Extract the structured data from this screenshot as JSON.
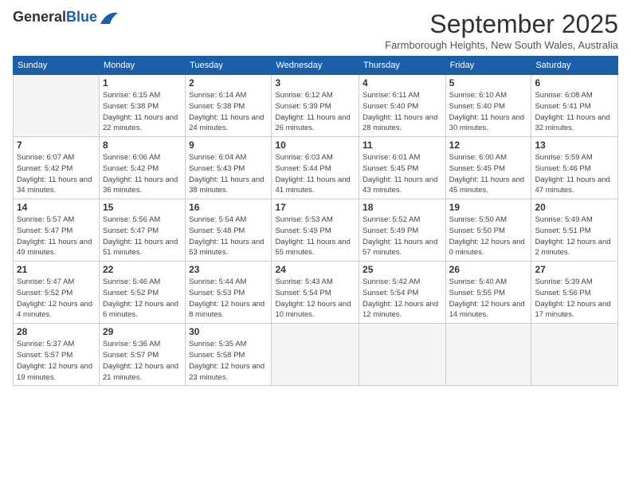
{
  "logo": {
    "general": "General",
    "blue": "Blue"
  },
  "title": "September 2025",
  "subtitle": "Farmborough Heights, New South Wales, Australia",
  "weekdays": [
    "Sunday",
    "Monday",
    "Tuesday",
    "Wednesday",
    "Thursday",
    "Friday",
    "Saturday"
  ],
  "weeks": [
    [
      {
        "day": "",
        "info": ""
      },
      {
        "day": "1",
        "info": "Sunrise: 6:15 AM\nSunset: 5:38 PM\nDaylight: 11 hours\nand 22 minutes."
      },
      {
        "day": "2",
        "info": "Sunrise: 6:14 AM\nSunset: 5:38 PM\nDaylight: 11 hours\nand 24 minutes."
      },
      {
        "day": "3",
        "info": "Sunrise: 6:12 AM\nSunset: 5:39 PM\nDaylight: 11 hours\nand 26 minutes."
      },
      {
        "day": "4",
        "info": "Sunrise: 6:11 AM\nSunset: 5:40 PM\nDaylight: 11 hours\nand 28 minutes."
      },
      {
        "day": "5",
        "info": "Sunrise: 6:10 AM\nSunset: 5:40 PM\nDaylight: 11 hours\nand 30 minutes."
      },
      {
        "day": "6",
        "info": "Sunrise: 6:08 AM\nSunset: 5:41 PM\nDaylight: 11 hours\nand 32 minutes."
      }
    ],
    [
      {
        "day": "7",
        "info": "Sunrise: 6:07 AM\nSunset: 5:42 PM\nDaylight: 11 hours\nand 34 minutes."
      },
      {
        "day": "8",
        "info": "Sunrise: 6:06 AM\nSunset: 5:42 PM\nDaylight: 11 hours\nand 36 minutes."
      },
      {
        "day": "9",
        "info": "Sunrise: 6:04 AM\nSunset: 5:43 PM\nDaylight: 11 hours\nand 38 minutes."
      },
      {
        "day": "10",
        "info": "Sunrise: 6:03 AM\nSunset: 5:44 PM\nDaylight: 11 hours\nand 41 minutes."
      },
      {
        "day": "11",
        "info": "Sunrise: 6:01 AM\nSunset: 5:45 PM\nDaylight: 11 hours\nand 43 minutes."
      },
      {
        "day": "12",
        "info": "Sunrise: 6:00 AM\nSunset: 5:45 PM\nDaylight: 11 hours\nand 45 minutes."
      },
      {
        "day": "13",
        "info": "Sunrise: 5:59 AM\nSunset: 5:46 PM\nDaylight: 11 hours\nand 47 minutes."
      }
    ],
    [
      {
        "day": "14",
        "info": "Sunrise: 5:57 AM\nSunset: 5:47 PM\nDaylight: 11 hours\nand 49 minutes."
      },
      {
        "day": "15",
        "info": "Sunrise: 5:56 AM\nSunset: 5:47 PM\nDaylight: 11 hours\nand 51 minutes."
      },
      {
        "day": "16",
        "info": "Sunrise: 5:54 AM\nSunset: 5:48 PM\nDaylight: 11 hours\nand 53 minutes."
      },
      {
        "day": "17",
        "info": "Sunrise: 5:53 AM\nSunset: 5:49 PM\nDaylight: 11 hours\nand 55 minutes."
      },
      {
        "day": "18",
        "info": "Sunrise: 5:52 AM\nSunset: 5:49 PM\nDaylight: 11 hours\nand 57 minutes."
      },
      {
        "day": "19",
        "info": "Sunrise: 5:50 AM\nSunset: 5:50 PM\nDaylight: 12 hours\nand 0 minutes."
      },
      {
        "day": "20",
        "info": "Sunrise: 5:49 AM\nSunset: 5:51 PM\nDaylight: 12 hours\nand 2 minutes."
      }
    ],
    [
      {
        "day": "21",
        "info": "Sunrise: 5:47 AM\nSunset: 5:52 PM\nDaylight: 12 hours\nand 4 minutes."
      },
      {
        "day": "22",
        "info": "Sunrise: 5:46 AM\nSunset: 5:52 PM\nDaylight: 12 hours\nand 6 minutes."
      },
      {
        "day": "23",
        "info": "Sunrise: 5:44 AM\nSunset: 5:53 PM\nDaylight: 12 hours\nand 8 minutes."
      },
      {
        "day": "24",
        "info": "Sunrise: 5:43 AM\nSunset: 5:54 PM\nDaylight: 12 hours\nand 10 minutes."
      },
      {
        "day": "25",
        "info": "Sunrise: 5:42 AM\nSunset: 5:54 PM\nDaylight: 12 hours\nand 12 minutes."
      },
      {
        "day": "26",
        "info": "Sunrise: 5:40 AM\nSunset: 5:55 PM\nDaylight: 12 hours\nand 14 minutes."
      },
      {
        "day": "27",
        "info": "Sunrise: 5:39 AM\nSunset: 5:56 PM\nDaylight: 12 hours\nand 17 minutes."
      }
    ],
    [
      {
        "day": "28",
        "info": "Sunrise: 5:37 AM\nSunset: 5:57 PM\nDaylight: 12 hours\nand 19 minutes."
      },
      {
        "day": "29",
        "info": "Sunrise: 5:36 AM\nSunset: 5:57 PM\nDaylight: 12 hours\nand 21 minutes."
      },
      {
        "day": "30",
        "info": "Sunrise: 5:35 AM\nSunset: 5:58 PM\nDaylight: 12 hours\nand 23 minutes."
      },
      {
        "day": "",
        "info": ""
      },
      {
        "day": "",
        "info": ""
      },
      {
        "day": "",
        "info": ""
      },
      {
        "day": "",
        "info": ""
      }
    ]
  ]
}
